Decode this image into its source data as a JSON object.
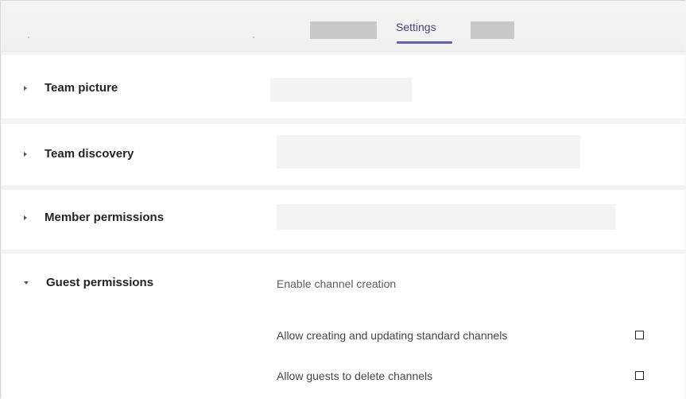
{
  "tabs": {
    "active_label": "Settings"
  },
  "sections": [
    {
      "title": "Team picture",
      "expanded": false
    },
    {
      "title": "Team discovery",
      "expanded": false
    },
    {
      "title": "Member permissions",
      "expanded": false
    },
    {
      "title": "Guest permissions",
      "expanded": true
    }
  ],
  "guest_permissions": {
    "subheading": "Enable channel creation",
    "options": [
      {
        "label": "Allow creating and updating standard channels",
        "checked": false
      },
      {
        "label": "Allow guests to delete channels",
        "checked": false
      }
    ]
  },
  "colors": {
    "accent": "#6264a7",
    "background": "#f3f3f3",
    "panel": "#ffffff"
  },
  "icons": {
    "collapsed": "caret-right-icon",
    "expanded": "caret-down-icon",
    "checkbox": "checkbox-empty-icon"
  }
}
